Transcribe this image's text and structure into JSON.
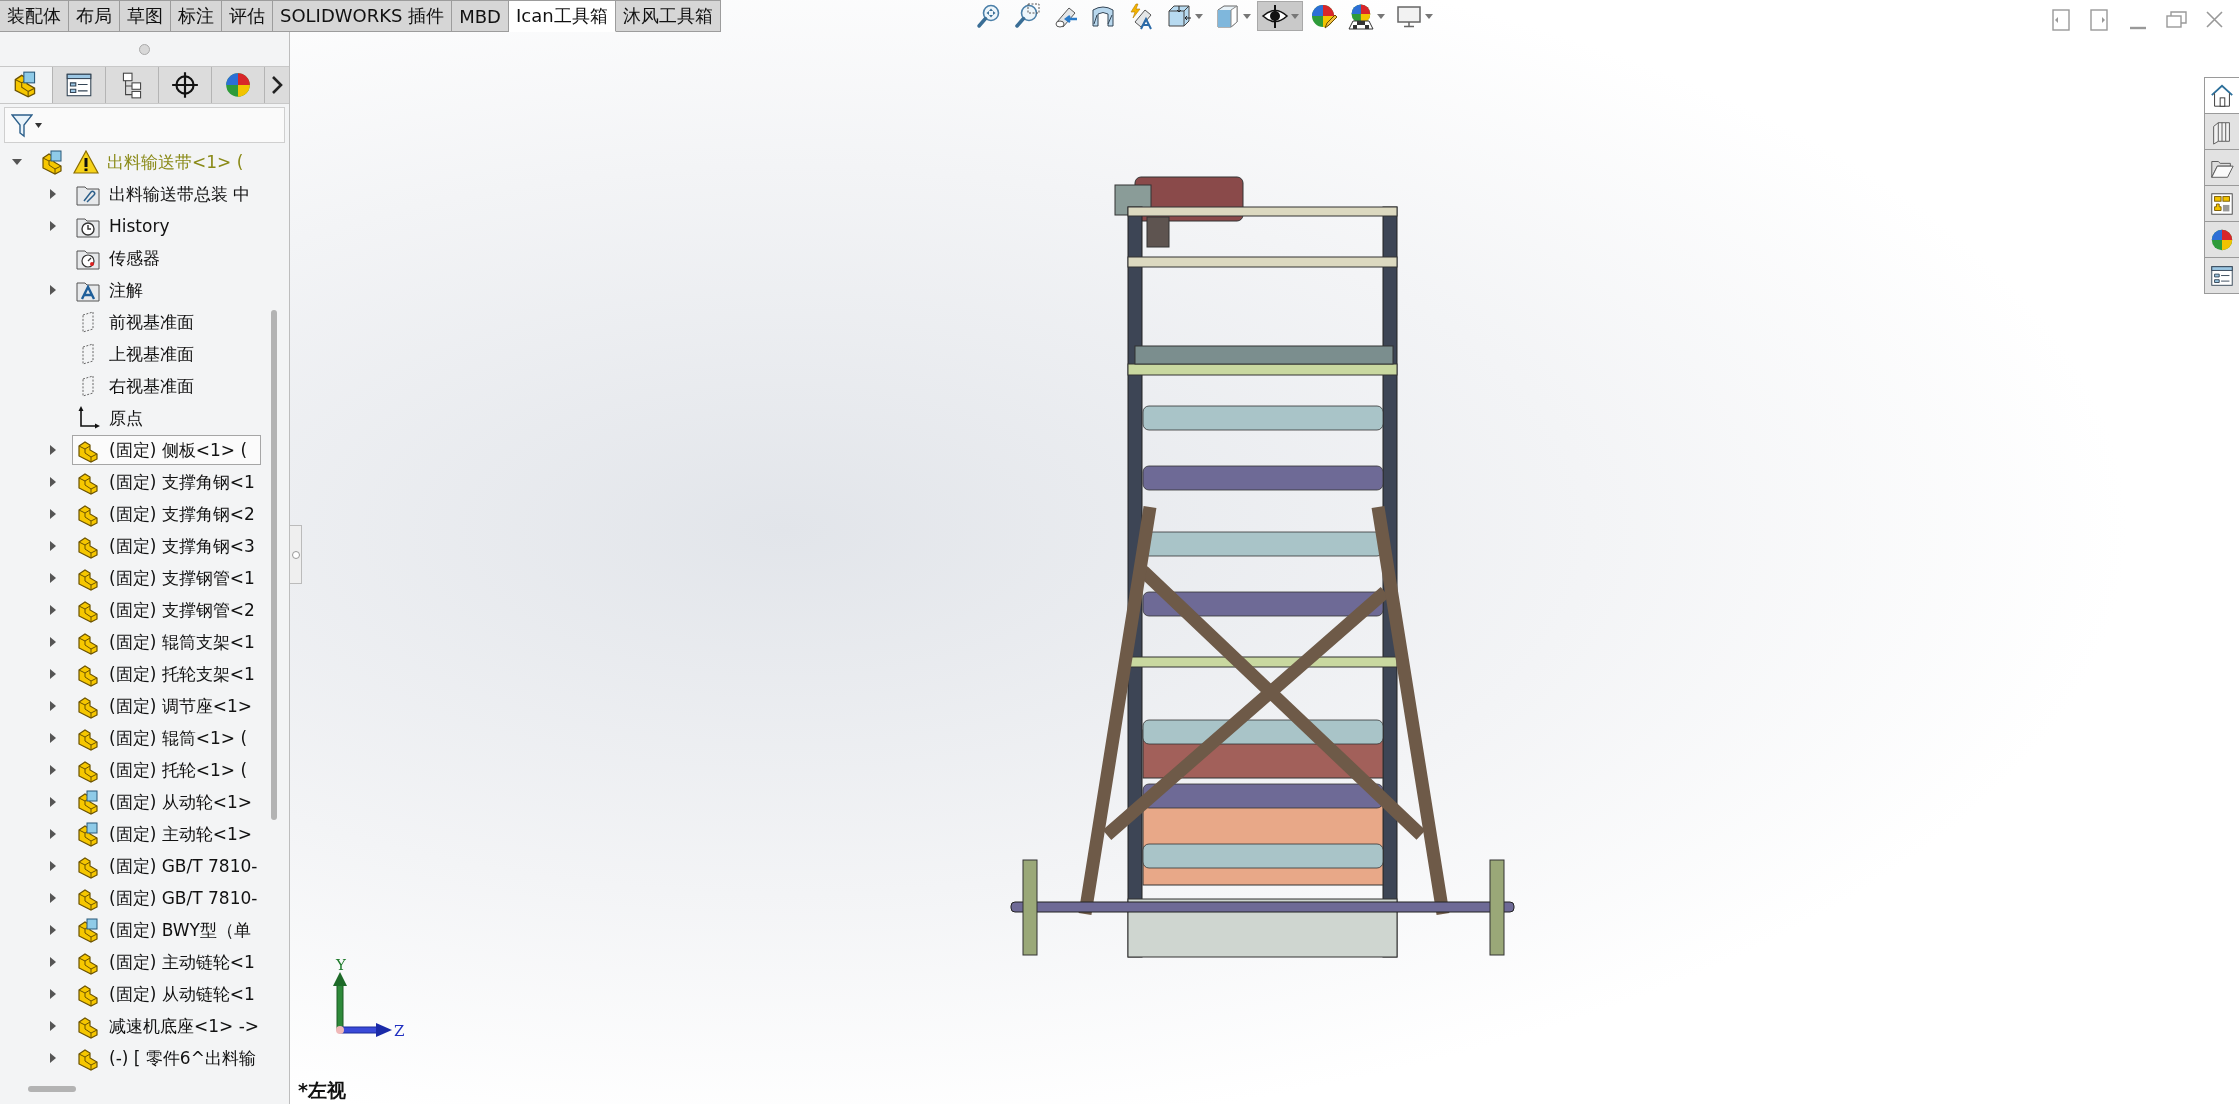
{
  "command_tabs": [
    {
      "label": "装配体",
      "selected": false
    },
    {
      "label": "布局",
      "selected": false
    },
    {
      "label": "草图",
      "selected": false
    },
    {
      "label": "标注",
      "selected": false
    },
    {
      "label": "评估",
      "selected": false
    },
    {
      "label": "SOLIDWORKS 插件",
      "selected": false
    },
    {
      "label": "MBD",
      "selected": false
    },
    {
      "label": "Ican工具箱",
      "selected": true
    },
    {
      "label": "沐风工具箱",
      "selected": false
    }
  ],
  "view_toolbar": [
    {
      "kind": "zoom-fit",
      "dropdown": false,
      "pressed": false
    },
    {
      "kind": "zoom-area",
      "dropdown": false,
      "pressed": false
    },
    {
      "kind": "previous-view",
      "dropdown": false,
      "pressed": false
    },
    {
      "kind": "section-view",
      "dropdown": false,
      "pressed": false
    },
    {
      "kind": "dynamic-annotation",
      "dropdown": false,
      "pressed": false
    },
    {
      "kind": "view-orientation",
      "dropdown": true,
      "pressed": false
    },
    {
      "kind": "display-style",
      "dropdown": true,
      "pressed": false
    },
    {
      "kind": "hide-show",
      "dropdown": true,
      "pressed": true
    },
    {
      "kind": "edit-appearance",
      "dropdown": false,
      "pressed": false
    },
    {
      "kind": "apply-scene",
      "dropdown": true,
      "pressed": false
    },
    {
      "kind": "view-settings",
      "dropdown": true,
      "pressed": false
    }
  ],
  "feature_manager": {
    "tabs": [
      {
        "kind": "feature-tree",
        "selected": true
      },
      {
        "kind": "property",
        "selected": false
      },
      {
        "kind": "configuration",
        "selected": false
      },
      {
        "kind": "dimxpert",
        "selected": false
      },
      {
        "kind": "display",
        "selected": false
      }
    ],
    "tree": [
      {
        "label": "出料输送带<1> (",
        "kind": "assembly",
        "warning": true,
        "expanded": true,
        "selected": false,
        "children": [
          {
            "label": "出料输送带总装 中",
            "kind": "folder-doc",
            "warning": false,
            "expanded": false,
            "selected": false
          },
          {
            "label": "History",
            "kind": "history",
            "warning": false,
            "expanded": false,
            "selected": false
          },
          {
            "label": "传感器",
            "kind": "sensor",
            "warning": false,
            "selected": false
          },
          {
            "label": "注解",
            "kind": "annotation",
            "warning": false,
            "expanded": false,
            "selected": false
          },
          {
            "label": "前视基准面",
            "kind": "plane",
            "warning": false,
            "selected": false
          },
          {
            "label": "上视基准面",
            "kind": "plane",
            "warning": false,
            "selected": false
          },
          {
            "label": "右视基准面",
            "kind": "plane",
            "warning": false,
            "selected": false
          },
          {
            "label": "原点",
            "kind": "origin",
            "warning": false,
            "selected": false
          },
          {
            "label": "(固定) 侧板<1> (",
            "kind": "part",
            "warning": false,
            "expanded": false,
            "selected": true
          },
          {
            "label": "(固定) 支撑角钢<1",
            "kind": "part",
            "warning": false,
            "expanded": false,
            "selected": false
          },
          {
            "label": "(固定) 支撑角钢<2",
            "kind": "part",
            "warning": false,
            "expanded": false,
            "selected": false
          },
          {
            "label": "(固定) 支撑角钢<3",
            "kind": "part",
            "warning": false,
            "expanded": false,
            "selected": false
          },
          {
            "label": "(固定) 支撑钢管<1",
            "kind": "part",
            "warning": false,
            "expanded": false,
            "selected": false
          },
          {
            "label": "(固定) 支撑钢管<2",
            "kind": "part",
            "warning": false,
            "expanded": false,
            "selected": false
          },
          {
            "label": "(固定) 辊筒支架<1",
            "kind": "part",
            "warning": false,
            "expanded": false,
            "selected": false
          },
          {
            "label": "(固定) 托轮支架<1",
            "kind": "part",
            "warning": false,
            "expanded": false,
            "selected": false
          },
          {
            "label": "(固定) 调节座<1>",
            "kind": "part",
            "warning": false,
            "expanded": false,
            "selected": false
          },
          {
            "label": "(固定) 辊筒<1> (",
            "kind": "part",
            "warning": false,
            "expanded": false,
            "selected": false
          },
          {
            "label": "(固定) 托轮<1> (",
            "kind": "part",
            "warning": false,
            "expanded": false,
            "selected": false
          },
          {
            "label": "(固定) 从动轮<1>",
            "kind": "assembly",
            "warning": false,
            "expanded": false,
            "selected": false
          },
          {
            "label": "(固定) 主动轮<1>",
            "kind": "assembly",
            "warning": false,
            "expanded": false,
            "selected": false
          },
          {
            "label": "(固定) GB/T 7810-",
            "kind": "part",
            "warning": false,
            "expanded": false,
            "selected": false
          },
          {
            "label": "(固定) GB/T 7810-",
            "kind": "part",
            "warning": false,
            "expanded": false,
            "selected": false
          },
          {
            "label": "(固定) BWY型（单",
            "kind": "assembly",
            "warning": false,
            "expanded": false,
            "selected": false
          },
          {
            "label": "(固定) 主动链轮<1",
            "kind": "part",
            "warning": false,
            "expanded": false,
            "selected": false
          },
          {
            "label": "(固定) 从动链轮<1",
            "kind": "part",
            "warning": false,
            "expanded": false,
            "selected": false
          },
          {
            "label": "减速机底座<1> ->",
            "kind": "part",
            "warning": false,
            "expanded": false,
            "selected": false
          },
          {
            "label": "(-) [ 零件6^出料输",
            "kind": "part",
            "warning": false,
            "expanded": false,
            "selected": false
          }
        ]
      }
    ]
  },
  "viewport": {
    "view_label": "*左视",
    "triad": {
      "y_label": "Y",
      "z_label": "Z"
    }
  },
  "task_pane_tabs": [
    {
      "kind": "home",
      "selected": true
    },
    {
      "kind": "library",
      "selected": false
    },
    {
      "kind": "file-explorer",
      "selected": false
    },
    {
      "kind": "view-palette",
      "selected": false
    },
    {
      "kind": "appearances",
      "selected": false
    },
    {
      "kind": "custom-properties",
      "selected": false
    }
  ]
}
